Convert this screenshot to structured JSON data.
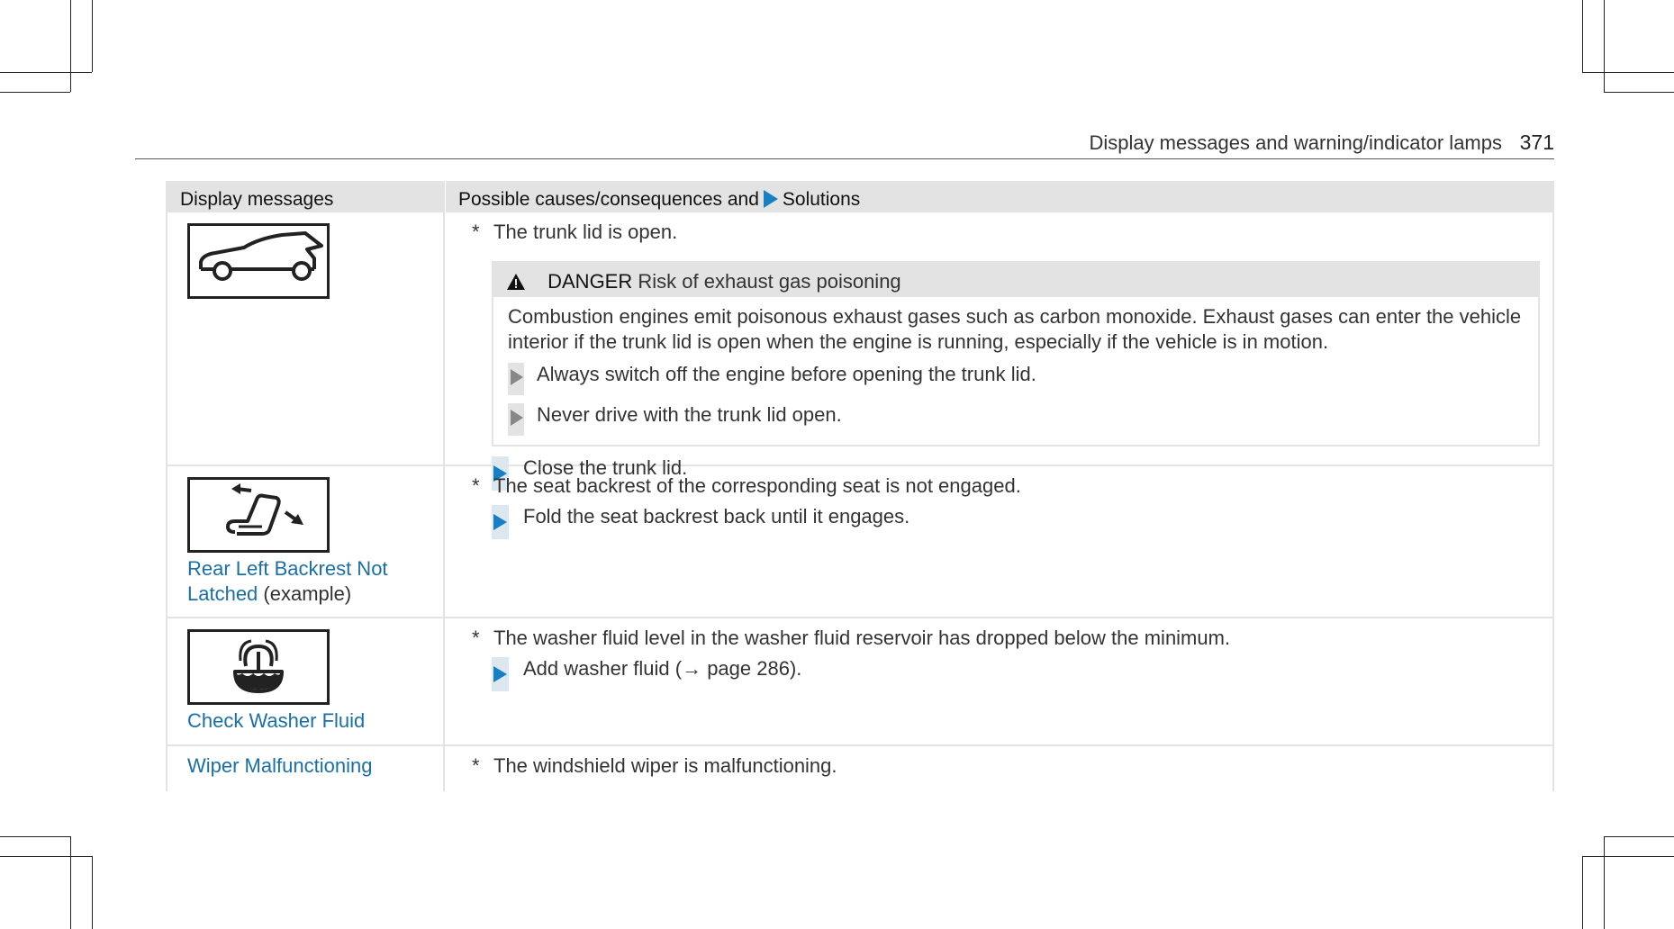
{
  "page_header": {
    "title": "Display messages and warning/indicator lamps",
    "page_number": "371"
  },
  "table": {
    "header": {
      "col1": "Display messages",
      "col2_before": "Possible causes/consequences and",
      "col2_after": "Solutions"
    },
    "rows": [
      {
        "symbol": "trunk-open-icon",
        "name": "",
        "cause": "The trunk lid is open.",
        "danger": {
          "label": "DANGER",
          "title": "Risk of exhaust gas poisoning",
          "body": "Combustion engines emit poisonous exhaust gases such as carbon monoxide. Exhaust gases can enter the vehicle interior if the trunk lid is open when the engine is running, especially if the vehicle is in motion.",
          "steps": [
            "Always switch off the engine before opening the trunk lid.",
            "Never drive with the trunk lid open."
          ]
        },
        "steps": [
          "Close the trunk lid."
        ]
      },
      {
        "symbol": "seat-backrest-icon",
        "name": "Rear Left Backrest Not Latched",
        "name_suffix": "(example)",
        "cause": "The seat backrest of the corresponding seat is not engaged.",
        "steps": [
          "Fold the seat backrest back until it engages."
        ]
      },
      {
        "symbol": "washer-fluid-icon",
        "name": "Check Washer Fluid",
        "cause": "The washer fluid level in the washer fluid reservoir has dropped below the minimum.",
        "steps": [
          "Add washer fluid (→ page 286)."
        ]
      },
      {
        "name": "Wiper Malfunctioning",
        "cause": "The windshield wiper is malfunctioning."
      }
    ]
  }
}
